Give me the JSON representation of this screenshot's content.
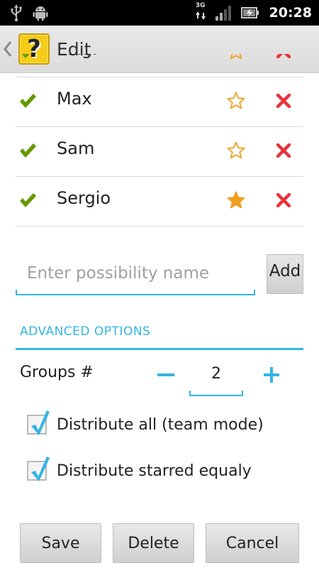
{
  "status_bar": {
    "network": "3G",
    "time": "20:28"
  },
  "action_bar": {
    "title": "Edit",
    "logo_glyph": "?"
  },
  "possibilities": [
    {
      "name": "Luigi",
      "checked": true,
      "starred": false
    },
    {
      "name": "Max",
      "checked": true,
      "starred": false
    },
    {
      "name": "Sam",
      "checked": true,
      "starred": false
    },
    {
      "name": "Sergio",
      "checked": true,
      "starred": true
    }
  ],
  "add_form": {
    "placeholder": "Enter possibility name",
    "value": "",
    "add_label": "Add"
  },
  "advanced": {
    "header": "ADVANCED OPTIONS",
    "groups_label": "Groups #",
    "groups_value": "2",
    "distribute_all_label": "Distribute all (team mode)",
    "distribute_all_checked": true,
    "distribute_starred_label": "Distribute starred equaly",
    "distribute_starred_checked": true
  },
  "buttons": {
    "save": "Save",
    "delete": "Delete",
    "cancel": "Cancel"
  },
  "colors": {
    "accent": "#33b5e5",
    "check_green": "#669900",
    "star_orange": "#f0a020",
    "remove_red": "#e8323c"
  }
}
